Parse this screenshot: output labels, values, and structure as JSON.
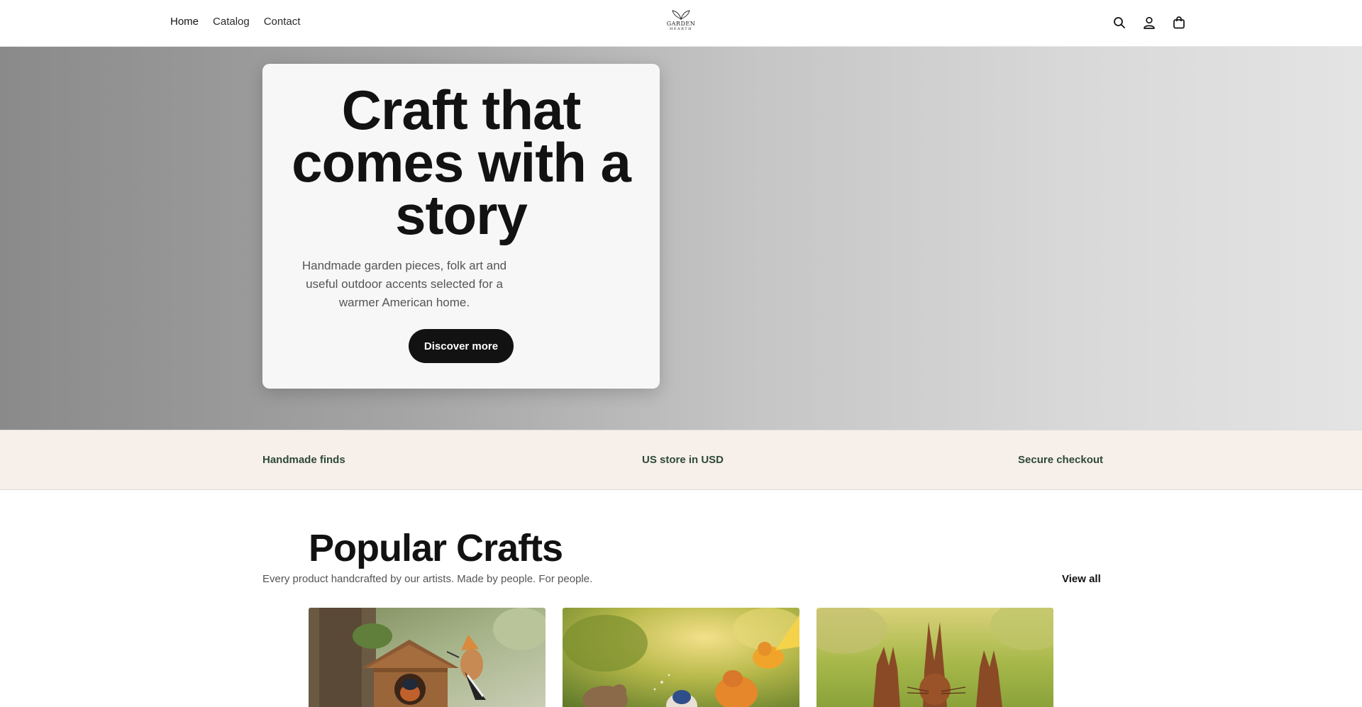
{
  "header": {
    "nav": [
      {
        "label": "Home"
      },
      {
        "label": "Catalog"
      },
      {
        "label": "Contact"
      }
    ],
    "logo": {
      "line1": "GARDEN",
      "line2": "HEARTH"
    },
    "icons": [
      "search-icon",
      "account-icon",
      "cart-icon"
    ]
  },
  "hero": {
    "title": "Craft that comes with a story",
    "subtitle": "Handmade garden pieces, folk art and useful outdoor accents selected for a warmer American home.",
    "button_label": "Discover more"
  },
  "trust": {
    "items": [
      "Handmade finds",
      "US store in USD",
      "Secure checkout"
    ]
  },
  "popular": {
    "title": "Popular Crafts",
    "subtitle": "Every product handcrafted by our artists. Made by people. For people.",
    "view_all": "View all",
    "products": [
      {
        "image": "birdhouse-with-hoopoe-and-robin"
      },
      {
        "image": "birds-in-sunny-garden"
      },
      {
        "image": "rusty-metal-rabbits-on-lawn"
      }
    ]
  },
  "colors": {
    "accent": "#121212",
    "trust_bg": "#f7efea",
    "trust_text": "#2d4a34"
  }
}
